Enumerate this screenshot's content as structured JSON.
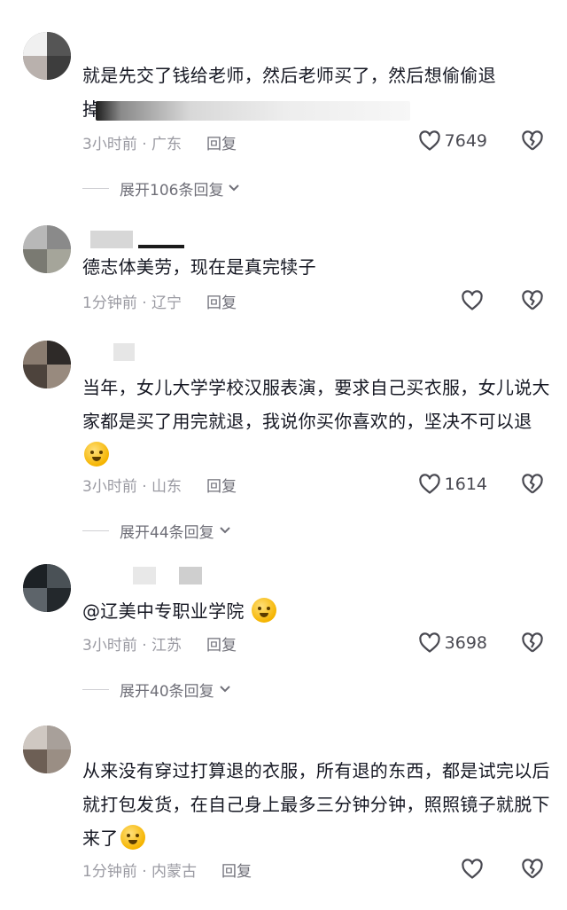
{
  "comments": [
    {
      "text_line1": "就是先交了钱给老师，然后老师买了，然后想偷偷退",
      "text_line2": "掉",
      "time_loc": "3小时前 · 广东",
      "reply": "回复",
      "likes": "7649",
      "expand": "展开106条回复"
    },
    {
      "text": "德志体美劳，现在是真完犊子",
      "time_loc": "1分钟前 · 辽宁",
      "reply": "回复"
    },
    {
      "text": "当年，女儿大学学校汉服表演，要求自己买衣服，女儿说大家都是买了用完就退，我说你买你喜欢的，坚决不可以退",
      "time_loc": "3小时前 · 山东",
      "reply": "回复",
      "likes": "1614",
      "expand": "展开44条回复"
    },
    {
      "text": "@辽美中专职业学院",
      "time_loc": "3小时前 · 江苏",
      "reply": "回复",
      "likes": "3698",
      "expand": "展开40条回复"
    },
    {
      "text": "从来没有穿过打算退的衣服，所有退的东西，都是试完以后就打包发货，在自己身上最多三分钟分钟，照照镜子就脱下来了",
      "time_loc": "1分钟前 · 内蒙古",
      "reply": "回复"
    }
  ],
  "icons": {
    "like": "heart-outline-icon",
    "dislike": "broken-heart-icon",
    "expand": "chevron-down-icon",
    "emoji": "crying-laugh-emoji-icon"
  }
}
